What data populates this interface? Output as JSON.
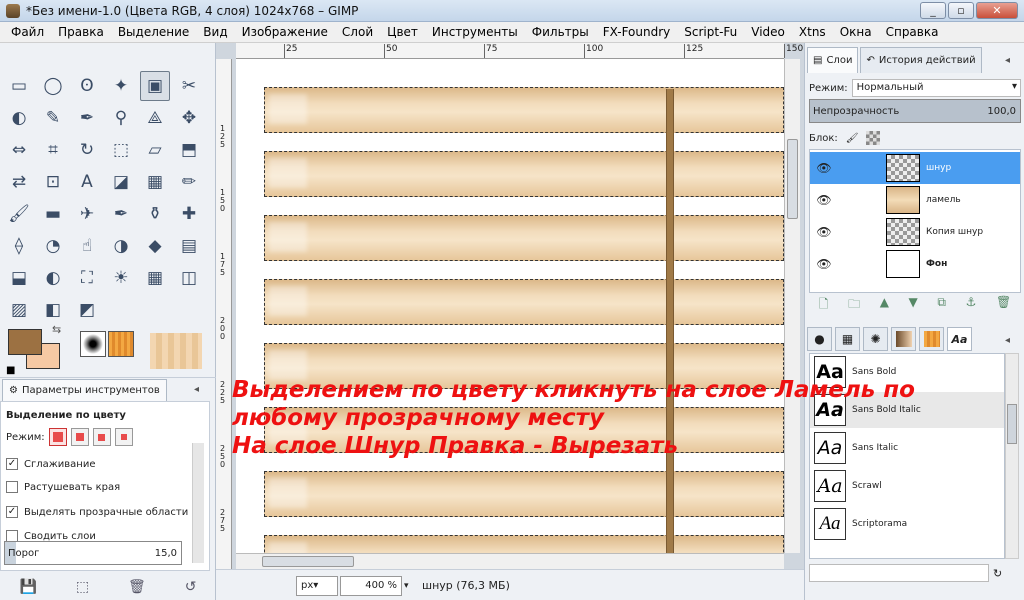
{
  "window": {
    "title": "*Без имени-1.0 (Цвета RGB, 4 слоя) 1024x768 – GIMP"
  },
  "menu": [
    "Файл",
    "Правка",
    "Выделение",
    "Вид",
    "Изображение",
    "Слой",
    "Цвет",
    "Инструменты",
    "Фильтры",
    "FX-Foundry",
    "Script-Fu",
    "Video",
    "Xtns",
    "Окна",
    "Справка"
  ],
  "toolbox": {
    "tool_icons": [
      "rect-select-icon",
      "ellipse-select-icon",
      "free-select-icon",
      "fuzzy-select-icon",
      "color-select-icon",
      "scissors-icon",
      "foreground-select-icon",
      "paths-icon",
      "color-picker-icon",
      "zoom-icon",
      "measure-icon",
      "move-icon",
      "align-icon",
      "crop-icon",
      "rotate-icon",
      "scale-icon",
      "shear-icon",
      "perspective-icon",
      "flip-icon",
      "cage-icon",
      "text-icon",
      "bucket-fill-icon",
      "blend-icon",
      "pencil-icon",
      "paintbrush-icon",
      "eraser-icon",
      "airbrush-icon",
      "ink-icon",
      "clone-icon",
      "heal-icon",
      "perspective-clone-icon",
      "blur-icon",
      "smudge-icon",
      "dodge-burn-icon",
      "sharpen-icon",
      "levels-icon",
      "color-balance-icon",
      "hue-icon",
      "colorize-icon",
      "brightness-icon",
      "threshold-icon",
      "curves-icon",
      "posterize-icon",
      "desaturate-icon",
      "invert-icon"
    ],
    "tool_glyphs": [
      "▭",
      "◯",
      "ʘ",
      "✦",
      "▣",
      "✂",
      "◐",
      "✎",
      "✒",
      "⚲",
      "⟁",
      "✥",
      "⇔",
      "⌗",
      "↻",
      "⬚",
      "▱",
      "⬒",
      "⇄",
      "⊡",
      "A",
      "◪",
      "▦",
      "✏",
      "🖌",
      "▬",
      "✈",
      "✒",
      "⚱",
      "✚",
      "⟠",
      "◔",
      "☝",
      "◑",
      "◆",
      "▤",
      "⬓",
      "◐",
      "⛶",
      "☀",
      "▦",
      "◫",
      "▨",
      "◧",
      "◩"
    ],
    "active_tool_index": 4,
    "fg_color": "#9c7142",
    "bg_color": "#f6c9a4",
    "options_tab_label": "Параметры инструментов",
    "options_heading": "Выделение по цвету",
    "mode_label": "Режим:",
    "antialias_label": "Сглаживание",
    "feather_label": "Растушевать края",
    "select_transparent_label": "Выделять прозрачные области",
    "sample_merged_label": "Сводить слои",
    "threshold_label": "Порог",
    "threshold_value": "15,0"
  },
  "rulers": {
    "h_labels": [
      "25",
      "50",
      "75",
      "100",
      "125",
      "150"
    ],
    "v_labels": [
      "125",
      "150",
      "175",
      "200",
      "225",
      "250",
      "275"
    ]
  },
  "status": {
    "unit": "px▾",
    "zoom": "400 %",
    "layer_info": "шнур (76,3 МБ)"
  },
  "annotation": [
    "Выделением по цвету кликнуть на слое Ламель по",
    "любому прозрачному месту",
    "На слое Шнур Правка - Вырезать"
  ],
  "layers_panel": {
    "tab_layers": "Слои",
    "tab_history": "История действий",
    "mode_label": "Режим:",
    "mode_value": "Нормальный",
    "opacity_label": "Непрозрачность",
    "opacity_value": "100,0",
    "lock_label": "Блок:",
    "layers": [
      {
        "name": "шнур",
        "selected": true,
        "thumb": "checker"
      },
      {
        "name": "ламель",
        "selected": false,
        "thumb": "wood"
      },
      {
        "name": "Копия шнур",
        "selected": false,
        "thumb": "checker"
      },
      {
        "name": "Фон",
        "selected": false,
        "thumb": "white"
      }
    ]
  },
  "fonts_panel": {
    "preview_glyph": "Aa",
    "fonts": [
      "Sans Bold",
      "Sans Bold Italic",
      "Sans Italic",
      "Scrawl",
      "Scriptorama"
    ]
  }
}
